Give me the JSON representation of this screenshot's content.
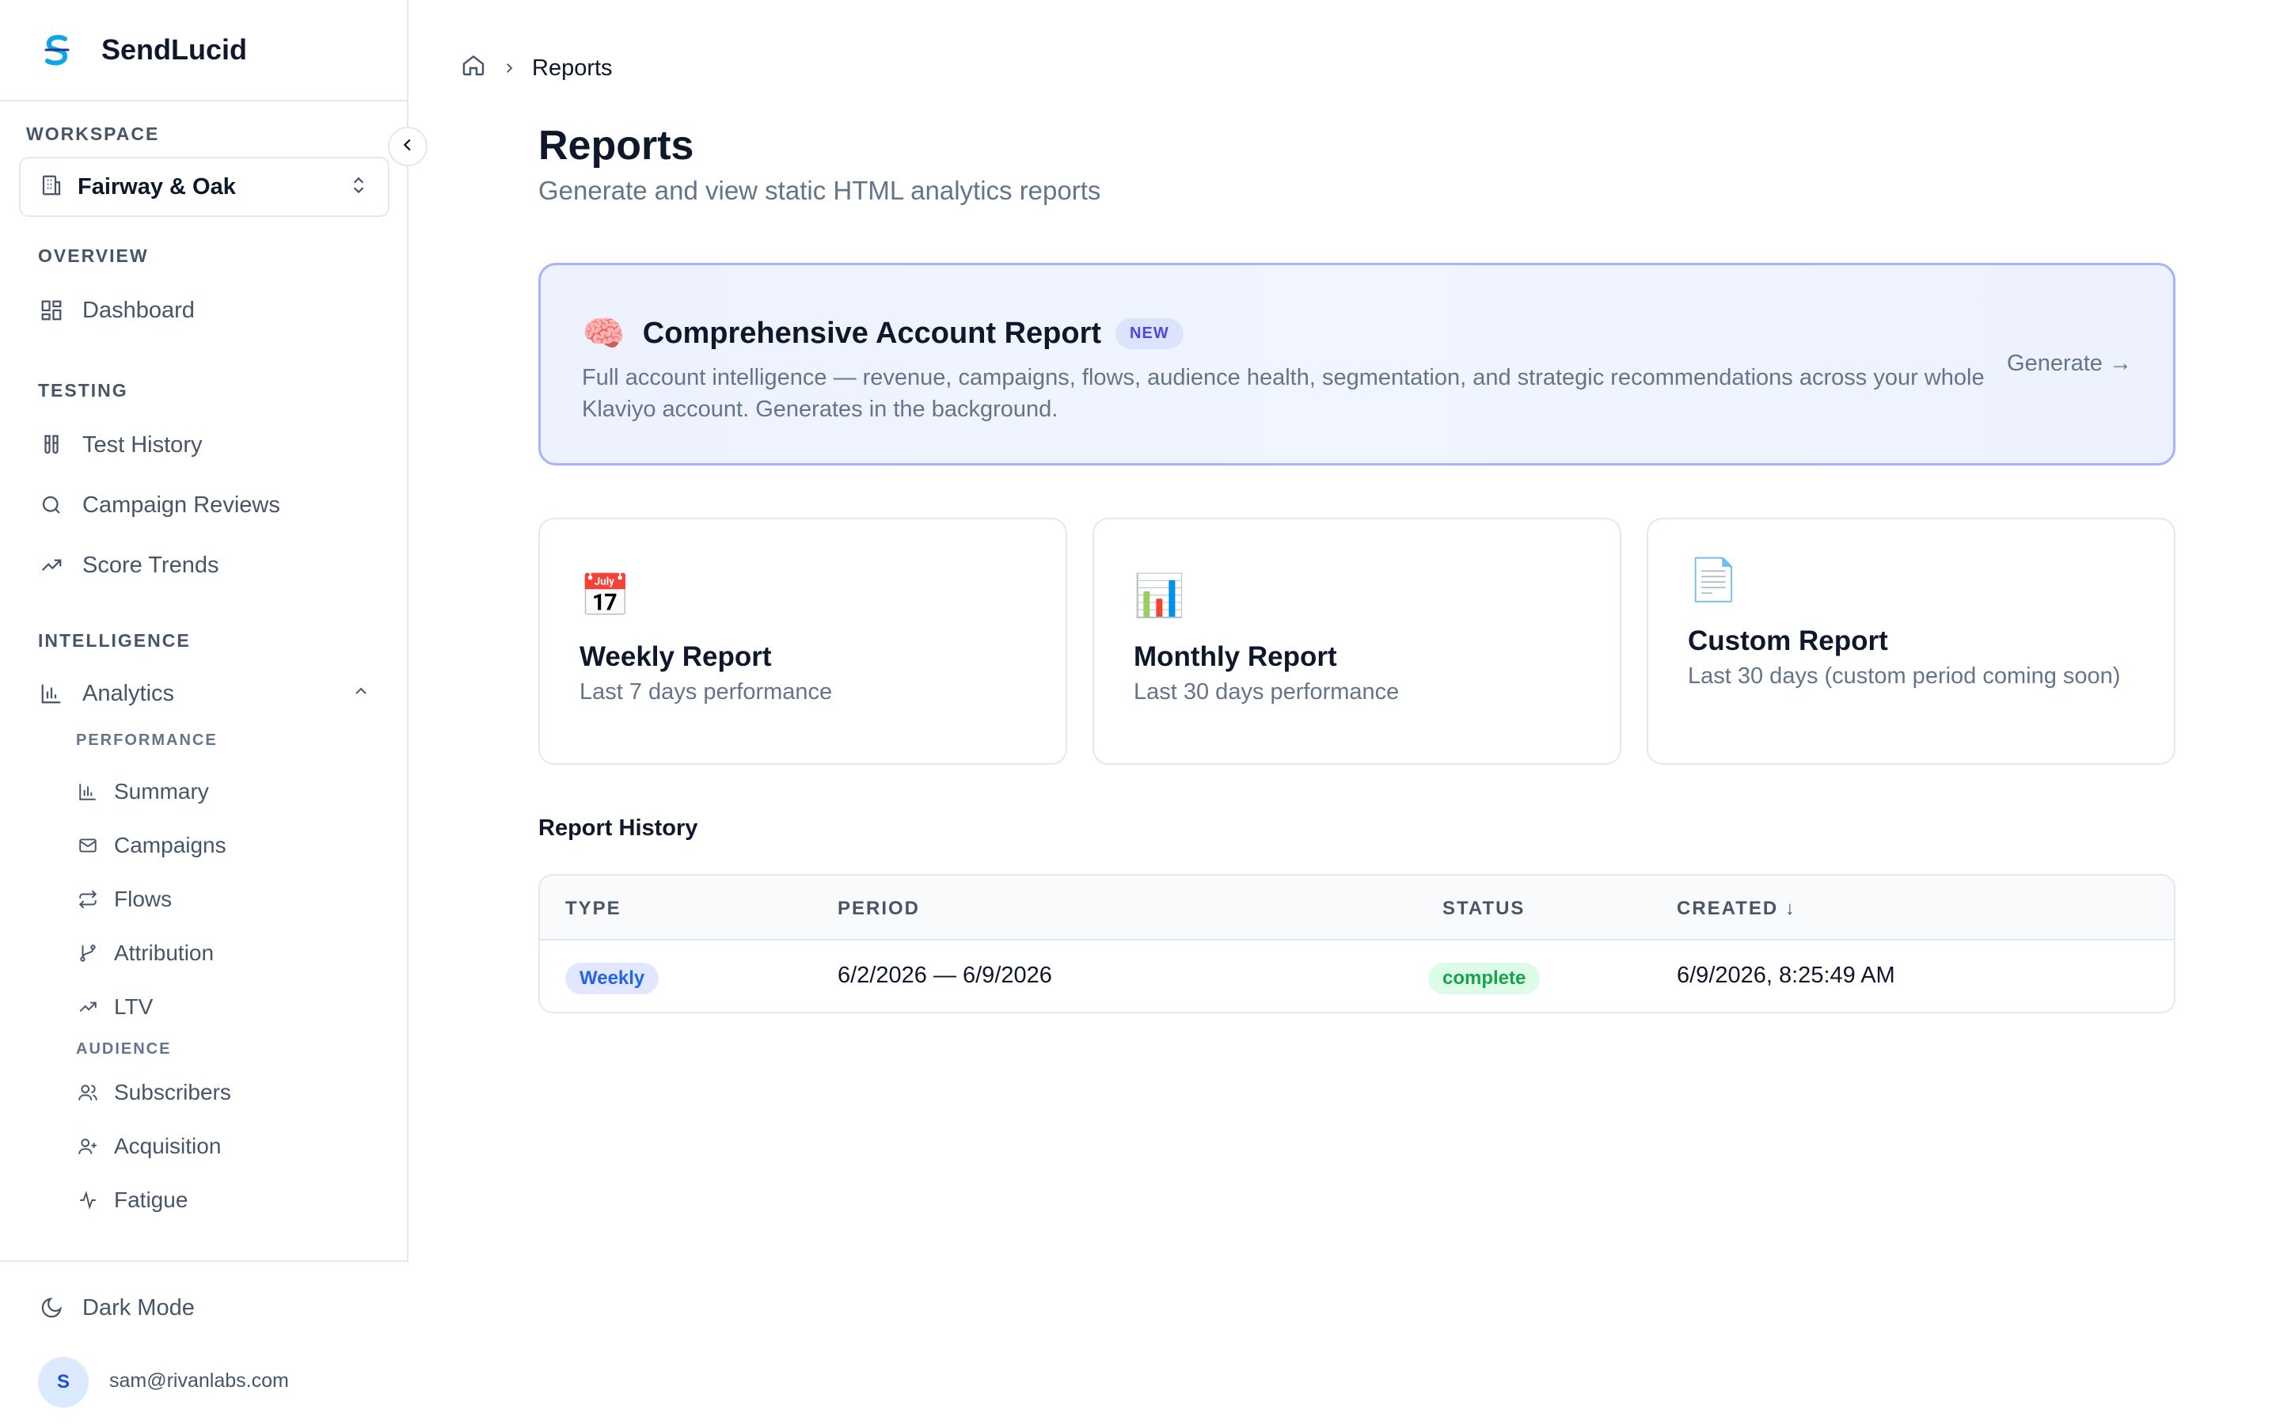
{
  "app": {
    "name": "SendLucid"
  },
  "sidebar": {
    "workspace_label": "WORKSPACE",
    "workspace_name": "Fairway & Oak",
    "groups": {
      "overview": "OVERVIEW",
      "testing": "TESTING",
      "intelligence": "INTELLIGENCE"
    },
    "items": {
      "dashboard": "Dashboard",
      "test_history": "Test History",
      "campaign_reviews": "Campaign Reviews",
      "score_trends": "Score Trends",
      "analytics": "Analytics"
    },
    "analytics_sub": {
      "performance_label": "PERFORMANCE",
      "summary": "Summary",
      "campaigns": "Campaigns",
      "flows": "Flows",
      "attribution": "Attribution",
      "ltv": "LTV",
      "audience_label": "AUDIENCE",
      "subscribers": "Subscribers",
      "acquisition": "Acquisition",
      "fatigue": "Fatigue"
    },
    "footer": {
      "dark_mode": "Dark Mode",
      "avatar_initial": "S",
      "email": "sam@rivanlabs.com"
    }
  },
  "breadcrumb": {
    "current": "Reports"
  },
  "page": {
    "title": "Reports",
    "subtitle": "Generate and view static HTML analytics reports"
  },
  "hero": {
    "emoji": "🧠",
    "title": "Comprehensive Account Report",
    "badge": "NEW",
    "description": "Full account intelligence — revenue, campaigns, flows, audience health, segmentation, and strategic recommendations across your whole Klaviyo account. Generates in the background.",
    "cta": "Generate →"
  },
  "cards": [
    {
      "emoji": "📅",
      "title": "Weekly Report",
      "description": "Last 7 days performance"
    },
    {
      "emoji": "📊",
      "title": "Monthly Report",
      "description": "Last 30 days performance"
    },
    {
      "emoji": "📄",
      "title": "Custom Report",
      "description": "Last 30 days (custom period coming soon)"
    }
  ],
  "history": {
    "title": "Report History",
    "columns": {
      "type": "TYPE",
      "period": "PERIOD",
      "status": "STATUS",
      "created": "CREATED ↓"
    },
    "rows": [
      {
        "type": "Weekly",
        "period": "6/2/2026 — 6/9/2026",
        "status": "complete",
        "created": "6/9/2026, 8:25:49 AM"
      }
    ]
  },
  "colors": {
    "accent": "#4f46e5",
    "hero_border": "#a5b4fc",
    "status_complete": "#16a34a",
    "type_pill": "#2563eb"
  }
}
